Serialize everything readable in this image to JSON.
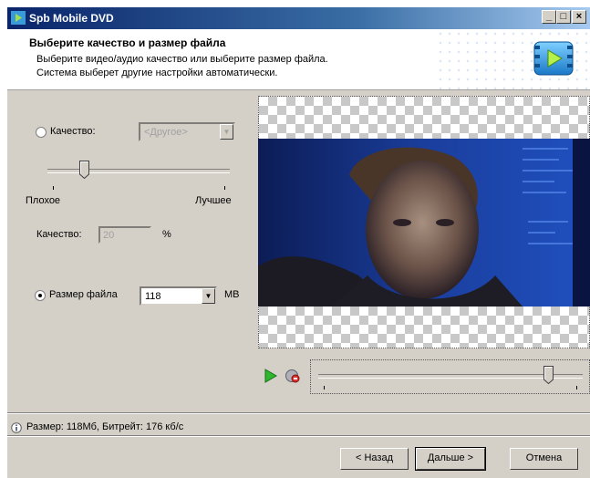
{
  "window": {
    "title": "Spb Mobile DVD",
    "controls": [
      "minimize",
      "maximize",
      "close"
    ]
  },
  "header": {
    "title": "Выберите качество и размер файла",
    "line1": "Выберите видео/аудио качество или выберите размер файла.",
    "line2": "Система выберет другие настройки автоматически."
  },
  "quality": {
    "radio_label": "Качество:",
    "selected": false,
    "preset_value": "<Другое>",
    "slider_low_label": "Плохое",
    "slider_high_label": "Лучшее",
    "slider_level": 0.2,
    "field_label": "Качество:",
    "field_value": "20",
    "field_unit": "%"
  },
  "filesize": {
    "radio_label": "Размер файла",
    "selected": true,
    "value": "118",
    "unit": "MB"
  },
  "playback": {
    "play_icon": "play-icon",
    "stop_icon": "stop-icon",
    "position": 0.87
  },
  "status": {
    "icon": "info-icon",
    "text": "Размер: 118Мб, Битрейт: 176 кб/с"
  },
  "buttons": {
    "back": "< Назад",
    "next": "Дальше >",
    "cancel": "Отмена"
  },
  "colors": {
    "titlebar_start": "#0a246a",
    "titlebar_end": "#a6caf0",
    "window_bg": "#d4d0c8",
    "video_bg": "#1a3e9c"
  }
}
